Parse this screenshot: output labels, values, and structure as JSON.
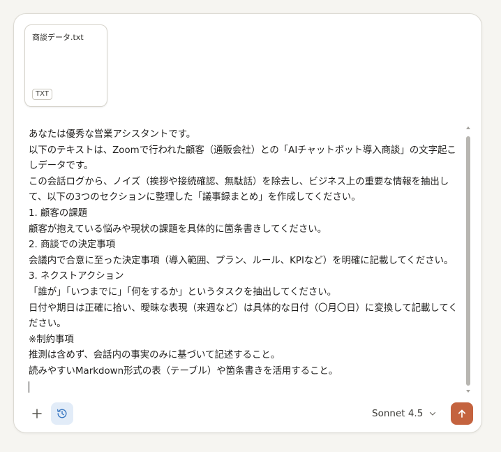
{
  "attachment": {
    "filename": "商談データ.txt",
    "type_badge": "TXT"
  },
  "prompt": {
    "text": "あなたは優秀な営業アシスタントです。\n以下のテキストは、Zoomで行われた顧客（通販会社）との「AIチャットボット導入商談」の文字起こしデータです。\nこの会話ログから、ノイズ（挨拶や接続確認、無駄話）を除去し、ビジネス上の重要な情報を抽出して、以下の3つのセクションに整理した「議事録まとめ」を作成してください。\n1. 顧客の課題\n顧客が抱えている悩みや現状の課題を具体的に箇条書きしてください。\n2. 商談での決定事項\n会議内で合意に至った決定事項（導入範囲、プラン、ルール、KPIなど）を明確に記載してください。\n3. ネクストアクション\n「誰が」「いつまでに」「何をするか」というタスクを抽出してください。\n日付や期日は正確に拾い、曖昧な表現（来週など）は具体的な日付（〇月〇日）に変換して記載してください。\n※制約事項\n推測は含めず、会話内の事実のみに基づいて記述すること。\n読みやすいMarkdown形式の表（テーブル）や箇条書きを活用すること。"
  },
  "toolbar": {
    "plus_icon": "plus-icon",
    "history_icon": "clock-icon",
    "model_label": "Sonnet 4.5",
    "send_icon": "arrow-up-icon"
  },
  "colors": {
    "accent": "#c4633f",
    "history_bg": "#e2ecf8",
    "history_icon": "#3a78c2"
  }
}
